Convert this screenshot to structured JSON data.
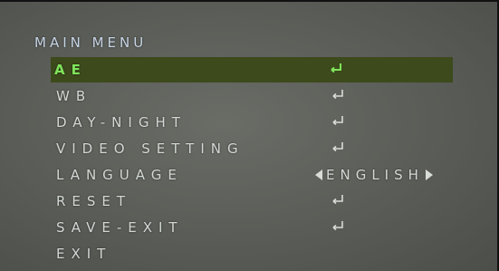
{
  "menu": {
    "title": "MAIN MENU",
    "items": [
      {
        "label": "AE",
        "control": "enter-icon",
        "selected": true
      },
      {
        "label": "WB",
        "control": "enter-icon",
        "selected": false
      },
      {
        "label": "DAY-NIGHT",
        "control": "enter-icon",
        "selected": false
      },
      {
        "label": "VIDEO SETTING",
        "control": "enter-icon",
        "selected": false
      },
      {
        "label": "LANGUAGE",
        "control": "value",
        "value": "ENGLISH",
        "selected": false
      },
      {
        "label": "RESET",
        "control": "enter-icon",
        "selected": false
      },
      {
        "label": "SAVE-EXIT",
        "control": "enter-icon",
        "selected": false
      },
      {
        "label": "EXIT",
        "control": "none",
        "selected": false
      }
    ]
  },
  "colors": {
    "background": "#5e605b",
    "text": "#d2d8d4",
    "title": "#c6d4e4",
    "selected_background": "#3c4a1c",
    "selected_text": "#7fe35a"
  }
}
